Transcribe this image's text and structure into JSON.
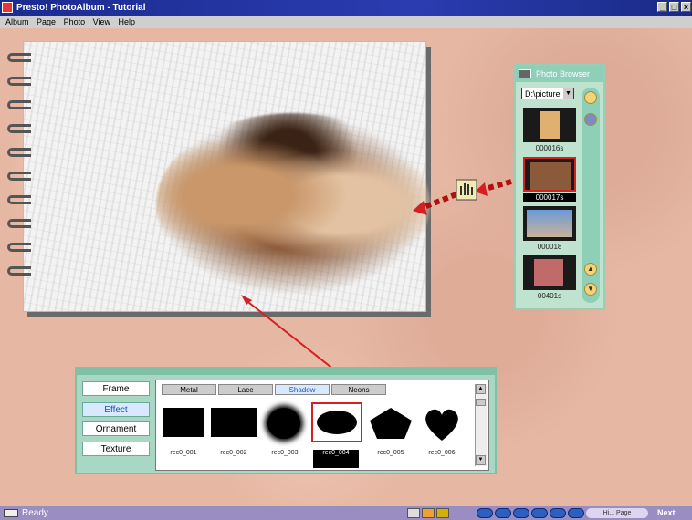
{
  "window": {
    "title": "Presto! PhotoAlbum - Tutorial"
  },
  "menu": [
    "Album",
    "Page",
    "Photo",
    "View",
    "Help"
  ],
  "photo_browser": {
    "title": "Photo Browser",
    "folder": "D:\\picture",
    "thumbnails": [
      {
        "label": "000016s"
      },
      {
        "label": "000017s",
        "selected": true
      },
      {
        "label": "000018"
      },
      {
        "label": "00401s"
      }
    ]
  },
  "panel": {
    "categories": [
      "Frame",
      "Effect",
      "Ornament",
      "Texture"
    ],
    "active_category": "Effect",
    "tabs": [
      "Metal",
      "Lace",
      "Shadow",
      "Neons"
    ],
    "active_tab": "Shadow",
    "shapes": [
      {
        "label": "rec0_001"
      },
      {
        "label": "rec0_002"
      },
      {
        "label": "rec0_003"
      },
      {
        "label": "rec0_004",
        "selected": true
      },
      {
        "label": "rec0_005"
      },
      {
        "label": "rec0_006"
      }
    ]
  },
  "status": {
    "text": "Ready",
    "pill": "Hi... Page",
    "next": "Next"
  },
  "colors": {
    "desk": "#e6b8a4",
    "title_bar": "#1b2b8f",
    "status_bar": "#9a8dc2",
    "accent_red": "#d42020",
    "panel_green": "#a8d8c4"
  }
}
